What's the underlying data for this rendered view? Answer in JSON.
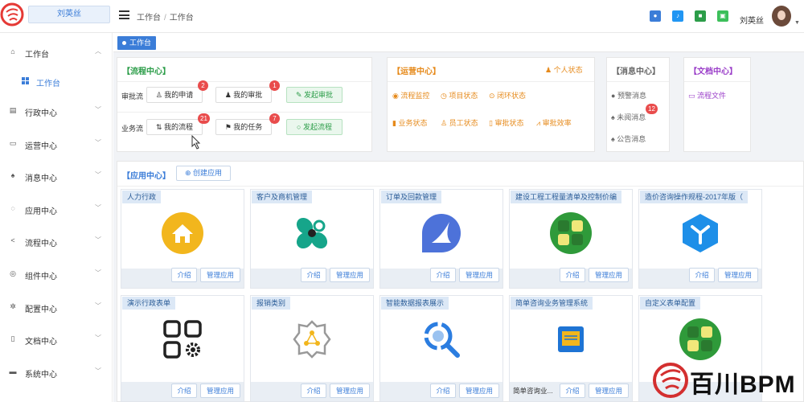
{
  "topbar": {
    "user_label": "刘英丝",
    "breadcrumb": [
      "工作台",
      "工作台"
    ],
    "username": "刘英丝"
  },
  "sidebar": {
    "items": [
      {
        "label": "工作台",
        "icon": "home-icon"
      },
      {
        "label": "行政中心",
        "icon": "calendar-icon"
      },
      {
        "label": "运营中心",
        "icon": "monitor-icon"
      },
      {
        "label": "消息中心",
        "icon": "bell-icon"
      },
      {
        "label": "应用中心",
        "icon": "app-icon"
      },
      {
        "label": "流程中心",
        "icon": "share-icon"
      },
      {
        "label": "组件中心",
        "icon": "component-icon"
      },
      {
        "label": "配置中心",
        "icon": "gear-icon"
      },
      {
        "label": "文档中心",
        "icon": "document-icon"
      },
      {
        "label": "系统中心",
        "icon": "system-icon"
      }
    ],
    "sub_item": "工作台"
  },
  "tabs": {
    "active": "工作台"
  },
  "process": {
    "title": "【流程中心】",
    "row1_label": "审批流",
    "row2_label": "业务流",
    "my_apply": "我的申请",
    "my_apply_count": "2",
    "my_approve": "我的审批",
    "my_approve_count": "1",
    "start_approve": "发起审批",
    "my_process": "我的流程",
    "my_process_count": "21",
    "my_task": "我的任务",
    "my_task_count": "7",
    "start_process": "发起流程"
  },
  "operation": {
    "title": "【运营中心】",
    "personal": "个人状态",
    "row1": [
      "流程监控",
      "项目状态",
      "闭环状态"
    ],
    "row2": [
      "业务状态",
      "员工状态",
      "审批状态",
      "审批效率"
    ]
  },
  "message": {
    "title": "【消息中心】",
    "items": [
      "预警消息",
      "未阅消息",
      "公告消息"
    ],
    "unread_count": "12"
  },
  "docs": {
    "title": "【文档中心】",
    "item": "流程文件"
  },
  "apps": {
    "title": "【应用中心】",
    "create": "创建应用",
    "intro": "介绍",
    "manage": "管理应用",
    "list": [
      {
        "name": "人力行政",
        "icon": "house-icon"
      },
      {
        "name": "客户及商机管理",
        "icon": "clover-icon"
      },
      {
        "name": "订单及回款管理",
        "icon": "sail-icon"
      },
      {
        "name": "建设工程工程量清单及控制价编",
        "icon": "grid-circle-icon"
      },
      {
        "name": "造价咨询操作规程-2017年版（",
        "icon": "hexagon-y-icon"
      },
      {
        "name": "演示行政表单",
        "icon": "blocks-gear-icon"
      },
      {
        "name": "报销类别",
        "icon": "gear-network-icon"
      },
      {
        "name": "智能数据报表展示",
        "icon": "search-chart-icon"
      },
      {
        "name": "简单咨询业务管理系统",
        "icon": "ethernet-icon",
        "caption": "简单咨询业..."
      },
      {
        "name": "自定义表单配置",
        "icon": "grid-circle-icon"
      }
    ]
  },
  "watermark": {
    "text": "百川BPM"
  },
  "colors": {
    "accent": "#3b7dd8",
    "green": "#2c9d49",
    "orange": "#e68a1b",
    "badge": "#e94c4c",
    "purple": "#9b3fc9"
  }
}
